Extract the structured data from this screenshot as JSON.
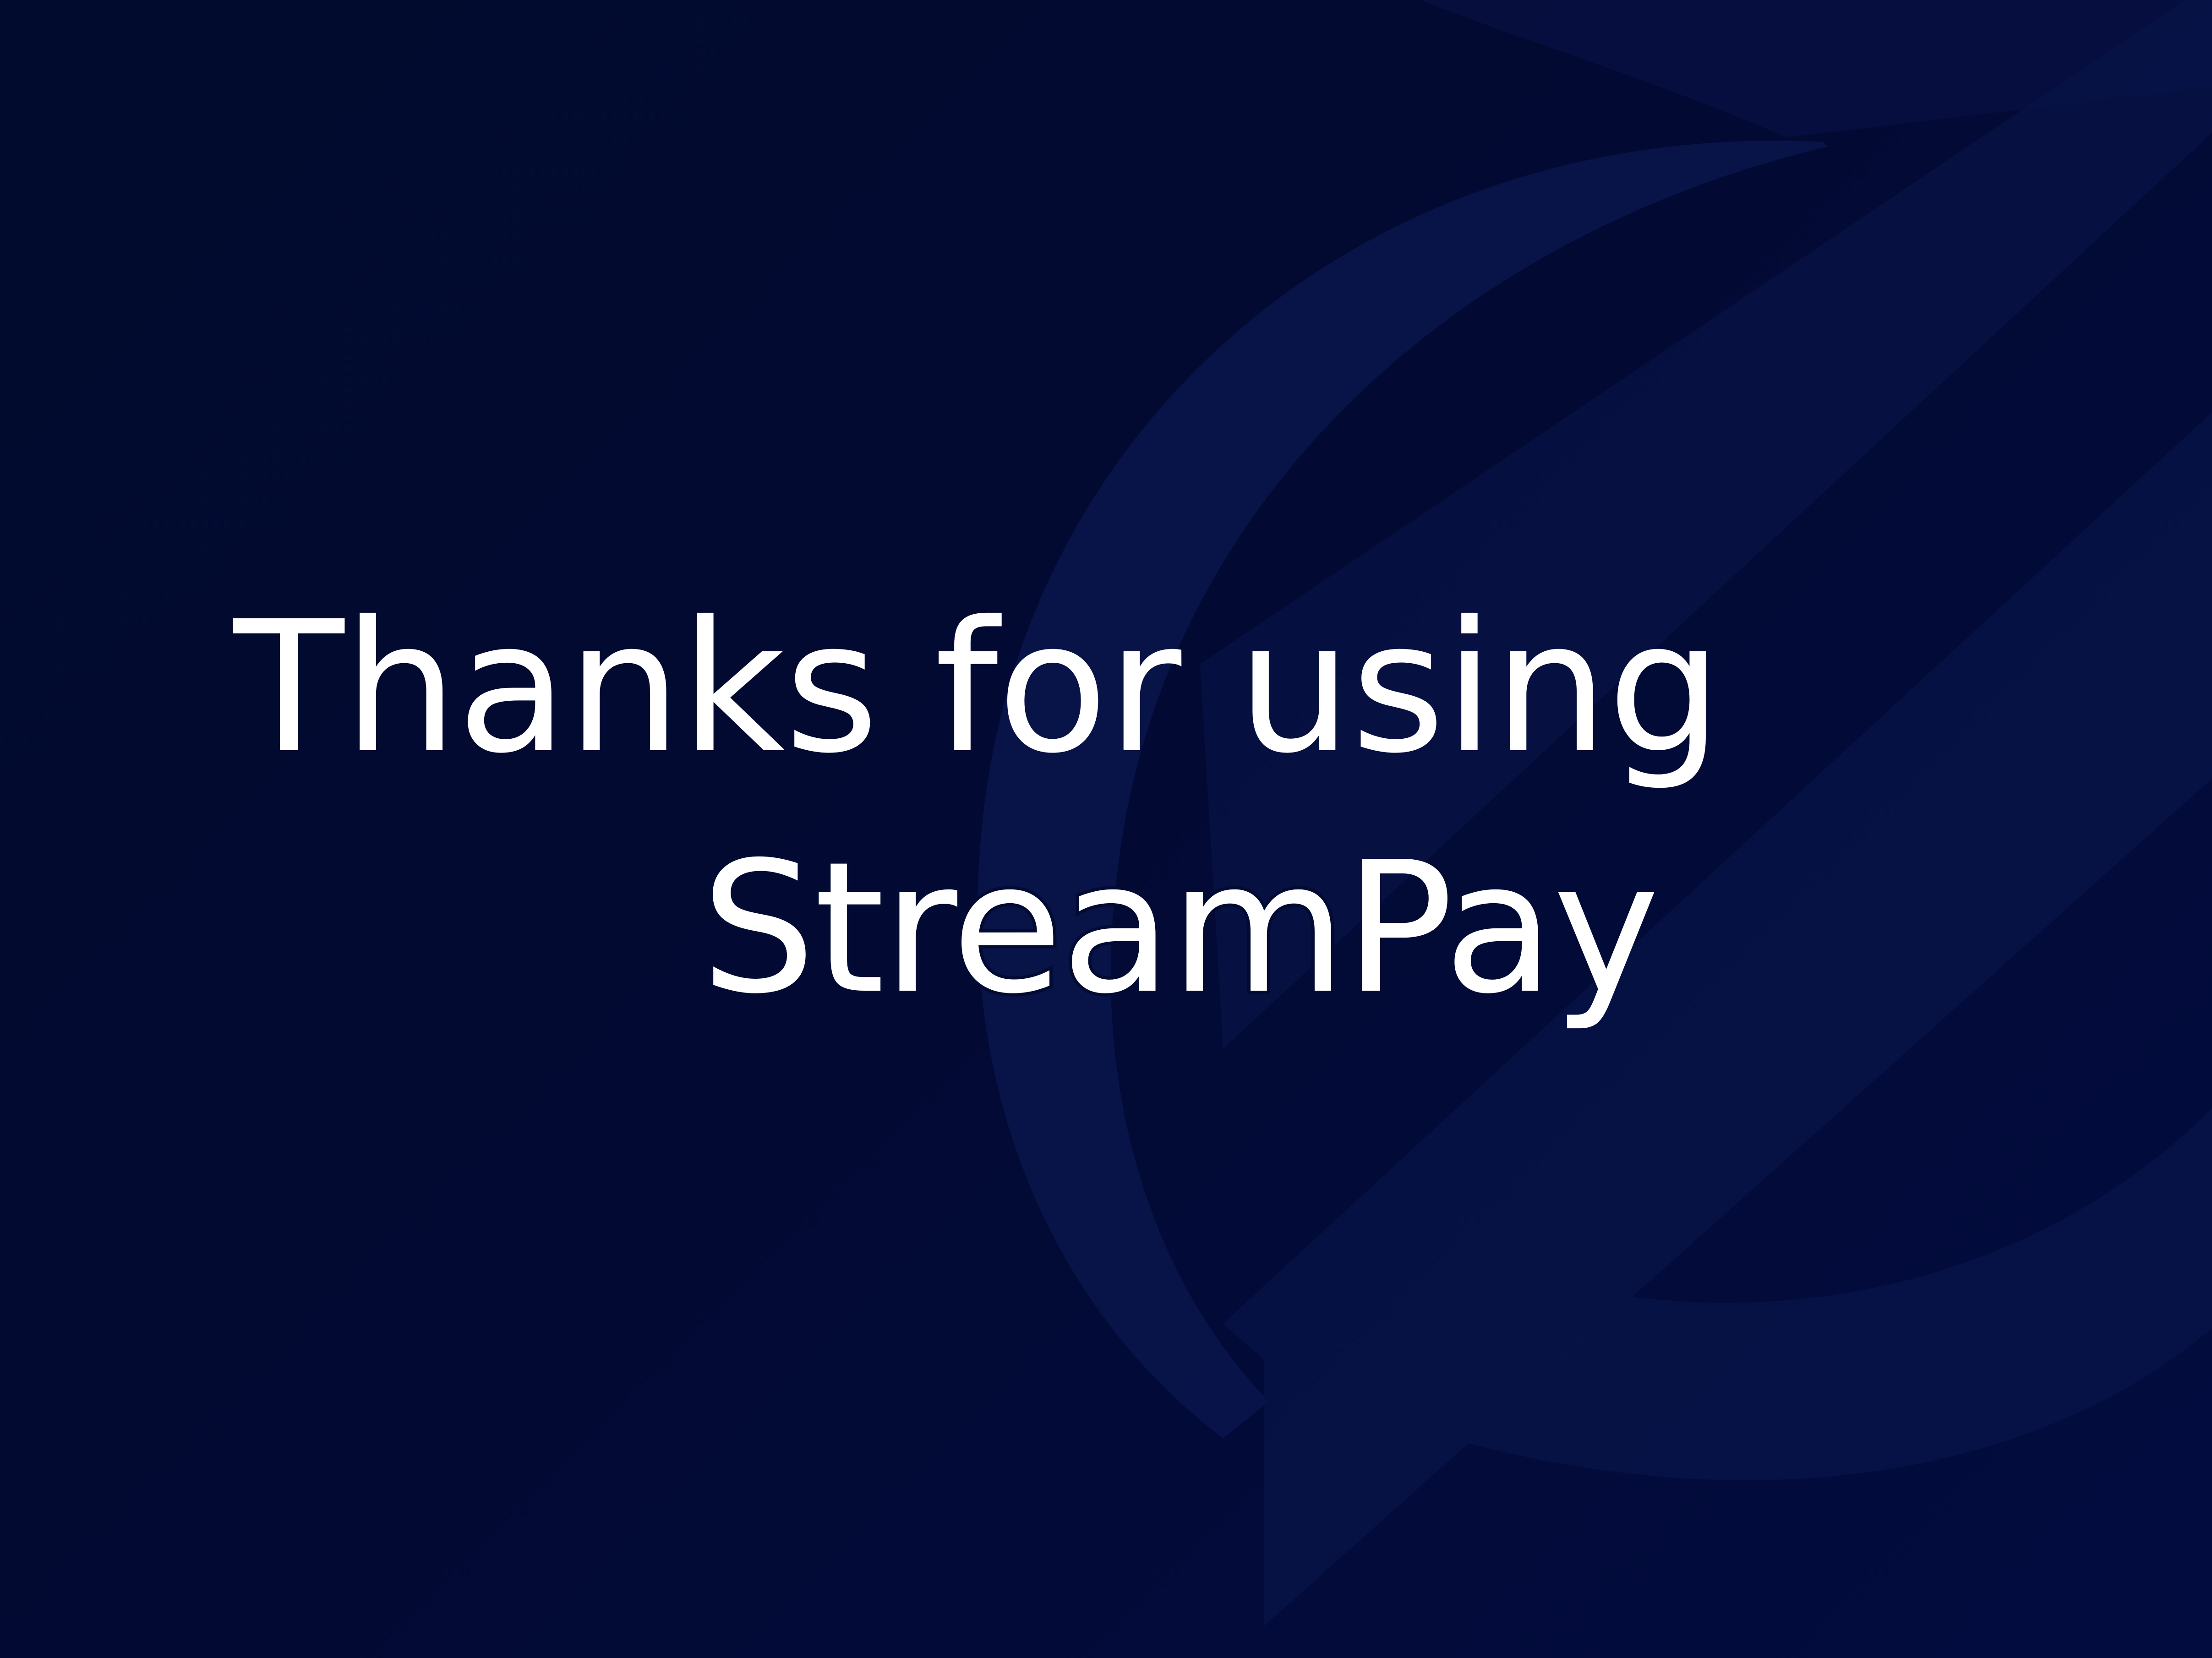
{
  "slide": {
    "headline": "Thanks for using",
    "brand_light": "Stream",
    "brand_bold": "Pay",
    "background_color": "#020a33",
    "logo_watermark_color": "#0d1a55",
    "text_color": "#ffffff",
    "watermark_icon": "streampay-logo-icon"
  }
}
